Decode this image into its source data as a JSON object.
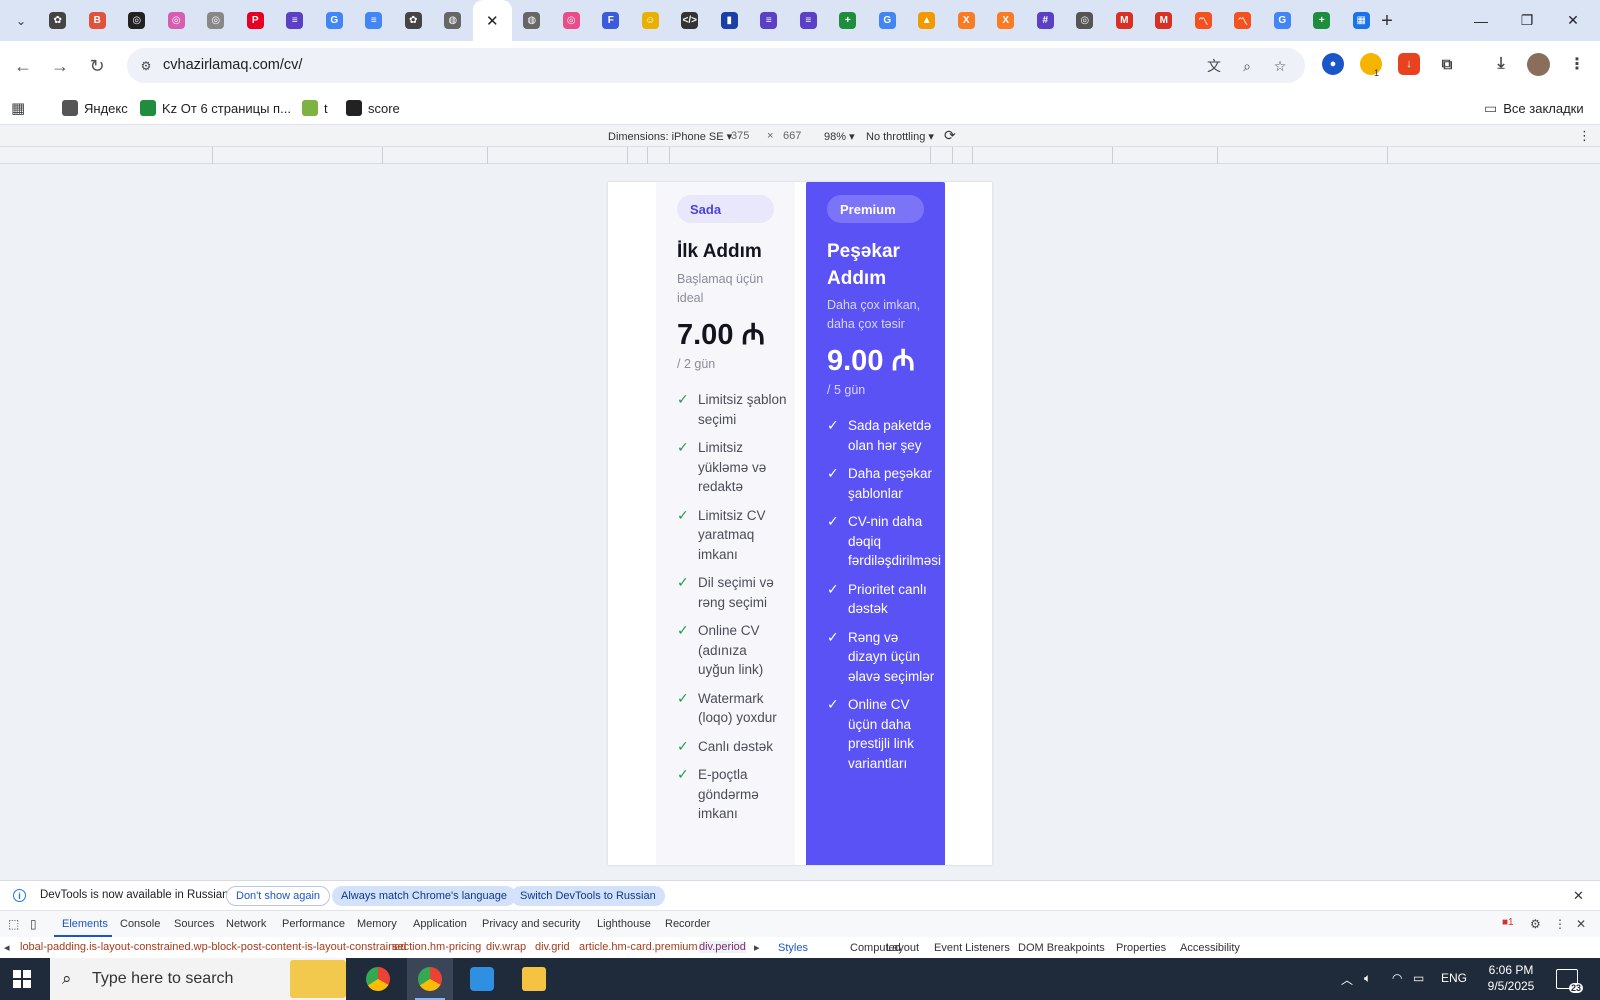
{
  "browser": {
    "tabs": [
      {
        "icon": "openai-icon",
        "color": "#444444",
        "glyph": "✿"
      },
      {
        "icon": "app-red-icon",
        "color": "#e0533a",
        "glyph": "B"
      },
      {
        "icon": "circle-dark-icon",
        "color": "#222222",
        "glyph": "◎"
      },
      {
        "icon": "pink-circle-icon",
        "color": "#d65db1",
        "glyph": "◎"
      },
      {
        "icon": "gray-circle-icon",
        "color": "#888888",
        "glyph": "◎"
      },
      {
        "icon": "pinterest-icon",
        "color": "#e60023",
        "glyph": "P"
      },
      {
        "icon": "purple-doc-icon",
        "color": "#5b3fc4",
        "glyph": "≡"
      },
      {
        "icon": "google-translate-icon",
        "color": "#4285f4",
        "glyph": "G"
      },
      {
        "icon": "google-docs-icon",
        "color": "#4285f4",
        "glyph": "≡"
      },
      {
        "icon": "openai-icon",
        "color": "#444444",
        "glyph": "✿"
      },
      {
        "icon": "globe-icon",
        "color": "#666666",
        "glyph": "◍"
      },
      {
        "icon": "close-icon",
        "color": "#222222",
        "glyph": "✕",
        "active": true
      },
      {
        "icon": "globe-icon",
        "color": "#666666",
        "glyph": "◍"
      },
      {
        "icon": "dribbble-icon",
        "color": "#ea4c89",
        "glyph": "◎"
      },
      {
        "icon": "blue-square-icon",
        "color": "#3b5bdb",
        "glyph": "F"
      },
      {
        "icon": "emoji-icon",
        "color": "#e8b000",
        "glyph": "☺"
      },
      {
        "icon": "code-icon",
        "color": "#333333",
        "glyph": "</>"
      },
      {
        "icon": "bar-chart-icon",
        "color": "#1a3fa6",
        "glyph": "▮"
      },
      {
        "icon": "purple-doc-icon",
        "color": "#5b3fc4",
        "glyph": "≡"
      },
      {
        "icon": "purple-doc-icon",
        "color": "#5b3fc4",
        "glyph": "≡"
      },
      {
        "icon": "green-plus-icon",
        "color": "#1e8e3e",
        "glyph": "+"
      },
      {
        "icon": "google-icon",
        "color": "#4285f4",
        "glyph": "G"
      },
      {
        "icon": "analytics-icon",
        "color": "#f29900",
        "glyph": "▲"
      },
      {
        "icon": "xampp-icon",
        "color": "#fb7a24",
        "glyph": "X"
      },
      {
        "icon": "xampp-icon",
        "color": "#fb7a24",
        "glyph": "X"
      },
      {
        "icon": "grid-app-icon",
        "color": "#5b3fc4",
        "glyph": "#"
      },
      {
        "icon": "chrome-icon",
        "color": "#555555",
        "glyph": "◎"
      },
      {
        "icon": "gmail-icon",
        "color": "#d93025",
        "glyph": "M"
      },
      {
        "icon": "gmail-icon",
        "color": "#d93025",
        "glyph": "M"
      },
      {
        "icon": "orange-app-icon",
        "color": "#f4511e",
        "glyph": "〽"
      },
      {
        "icon": "orange-app-icon",
        "color": "#f4511e",
        "glyph": "〽"
      },
      {
        "icon": "google-icon",
        "color": "#4285f4",
        "glyph": "G"
      },
      {
        "icon": "green-plus-icon",
        "color": "#1e8e3e",
        "glyph": "+"
      },
      {
        "icon": "grid-app-icon",
        "color": "#1a73e8",
        "glyph": "▦"
      }
    ],
    "url": "cvhazirlamaq.com/cv/",
    "bookmarks": [
      {
        "label": "Яндекс",
        "icon": "globe-icon",
        "color": "#555555"
      },
      {
        "label": "Kz От 6 страницы п...",
        "icon": "green-plus-icon",
        "color": "#1e8e3e"
      },
      {
        "label": "t",
        "icon": "plant-icon",
        "color": "#7cb342"
      },
      {
        "label": "score",
        "icon": "chart-line-icon",
        "color": "#222222"
      }
    ],
    "all_bookmarks": "Все закладки",
    "extension_badge": "1"
  },
  "device_toolbar": {
    "dimensions": "Dimensions: iPhone SE",
    "width": "375",
    "times": "×",
    "height": "667",
    "zoom": "98%",
    "throttling": "No throttling"
  },
  "pricing": {
    "basic": {
      "badge": "Sada",
      "title": "İlk Addım",
      "subtitle": "Başlamaq üçün ideal",
      "price": "7.00 ₼",
      "period": "/ 2 gün",
      "features": [
        "Limitsiz şablon seçimi",
        "Limitsiz yükləmə və redaktə",
        "Limitsiz CV yaratmaq imkanı",
        "Dil seçimi və rəng seçimi",
        "Online CV (adınıza uyğun link)",
        "Watermark (loqo) yoxdur",
        "Canlı dəstək",
        "E-poçtla göndərmə imkanı"
      ]
    },
    "premium": {
      "badge": "Premium",
      "title": "Peşəkar Addım",
      "subtitle": "Daha çox imkan, daha çox təsir",
      "price": "9.00 ₼",
      "period": "/ 5 gün",
      "features": [
        "Sada paketdə olan hər şey",
        "Daha peşəkar şablonlar",
        "CV-nin daha dəqiq fərdiləşdirilməsi",
        "Prioritet canlı dəstək",
        "Rəng və dizayn üçün əlavə seçimlər",
        "Online CV üçün daha prestijli link variantları"
      ],
      "accent": "#5b52f5"
    }
  },
  "devtools": {
    "info_message": "DevTools is now available in Russian",
    "dont_show": "Don't show again",
    "always_match": "Always match Chrome's language",
    "switch_russian": "Switch DevTools to Russian",
    "tabs": [
      "Elements",
      "Console",
      "Sources",
      "Network",
      "Performance",
      "Memory",
      "Application",
      "Privacy and security",
      "Lighthouse",
      "Recorder"
    ],
    "error_count": "1",
    "breadcrumbs": [
      "lobal-padding.is-layout-constrained.wp-block-post-content-is-layout-constrained",
      "section.hm-pricing",
      "div.wrap",
      "div.grid",
      "article.hm-card.premium",
      "div.period"
    ],
    "side_tabs": [
      "Styles",
      "Computed",
      "Layout",
      "Event Listeners",
      "DOM Breakpoints",
      "Properties",
      "Accessibility"
    ]
  },
  "taskbar": {
    "search_placeholder": "Type here to search",
    "language": "ENG",
    "time": "6:06 PM",
    "date": "9/5/2025",
    "notification_count": "23"
  }
}
